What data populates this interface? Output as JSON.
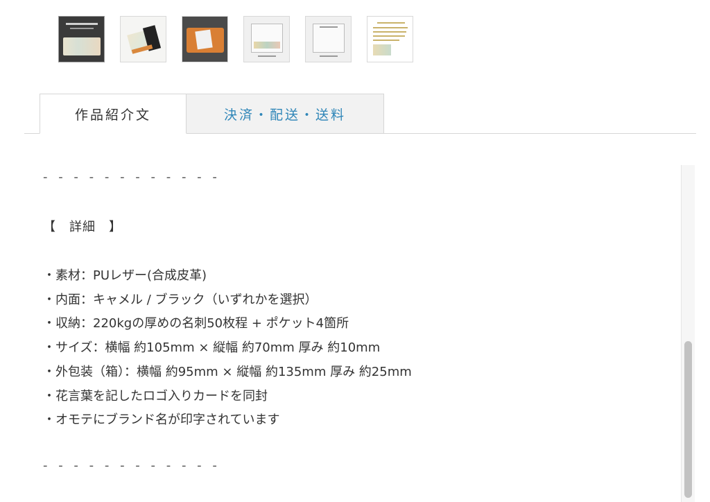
{
  "thumbnails": [
    {
      "name": "thumbnail-1"
    },
    {
      "name": "thumbnail-2"
    },
    {
      "name": "thumbnail-3"
    },
    {
      "name": "thumbnail-4"
    },
    {
      "name": "thumbnail-5"
    },
    {
      "name": "thumbnail-6"
    }
  ],
  "tabs": [
    {
      "label": "作品紹介文",
      "active": true
    },
    {
      "label": "決済・配送・送料",
      "active": false
    }
  ],
  "content": {
    "separator_top": "- - - - - - - - - - - -",
    "heading": "【　詳細　】",
    "details": [
      "・素材：PUレザー(合成皮革)",
      "・内面：キャメル / ブラック（いずれかを選択）",
      "・収納：220kgの厚めの名刺50枚程 + ポケット4箇所",
      "・サイズ：横幅 約105mm × 縦幅 約70mm 厚み 約10mm",
      "・外包装（箱）：横幅 約95mm × 縦幅 約135mm 厚み 約25mm",
      "・花言葉を記したロゴ入りカードを同封",
      "・オモテにブランド名が印字されています"
    ],
    "separator_bottom": "- - - - - - - - - - - -"
  },
  "colors": {
    "tab_inactive_text": "#2f86b8",
    "tab_inactive_bg": "#f2f2f2",
    "text": "#333333"
  }
}
